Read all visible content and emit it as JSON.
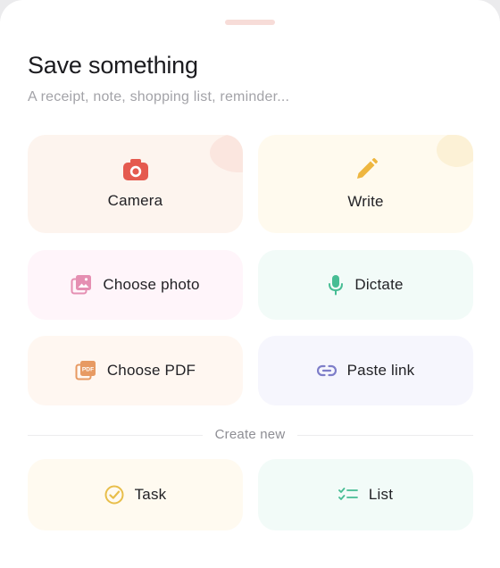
{
  "sheet": {
    "title": "Save something",
    "subtitle": "A receipt, note, shopping list, reminder..."
  },
  "options": {
    "camera": {
      "label": "Camera",
      "icon": "camera-icon",
      "color": "#e55a4f"
    },
    "write": {
      "label": "Write",
      "icon": "pencil-icon",
      "color": "#eeb63f"
    },
    "choose_photo": {
      "label": "Choose photo",
      "icon": "photo-library-icon",
      "color": "#e58fb2"
    },
    "dictate": {
      "label": "Dictate",
      "icon": "microphone-icon",
      "color": "#47bd94"
    },
    "choose_pdf": {
      "label": "Choose PDF",
      "icon": "pdf-file-icon",
      "color": "#e79a63"
    },
    "paste_link": {
      "label": "Paste link",
      "icon": "link-icon",
      "color": "#7e7ec9"
    }
  },
  "create_new": {
    "divider_label": "Create new",
    "task": {
      "label": "Task",
      "icon": "check-circle-icon",
      "color": "#e8be4a"
    },
    "list": {
      "label": "List",
      "icon": "checklist-icon",
      "color": "#47bd94"
    }
  }
}
